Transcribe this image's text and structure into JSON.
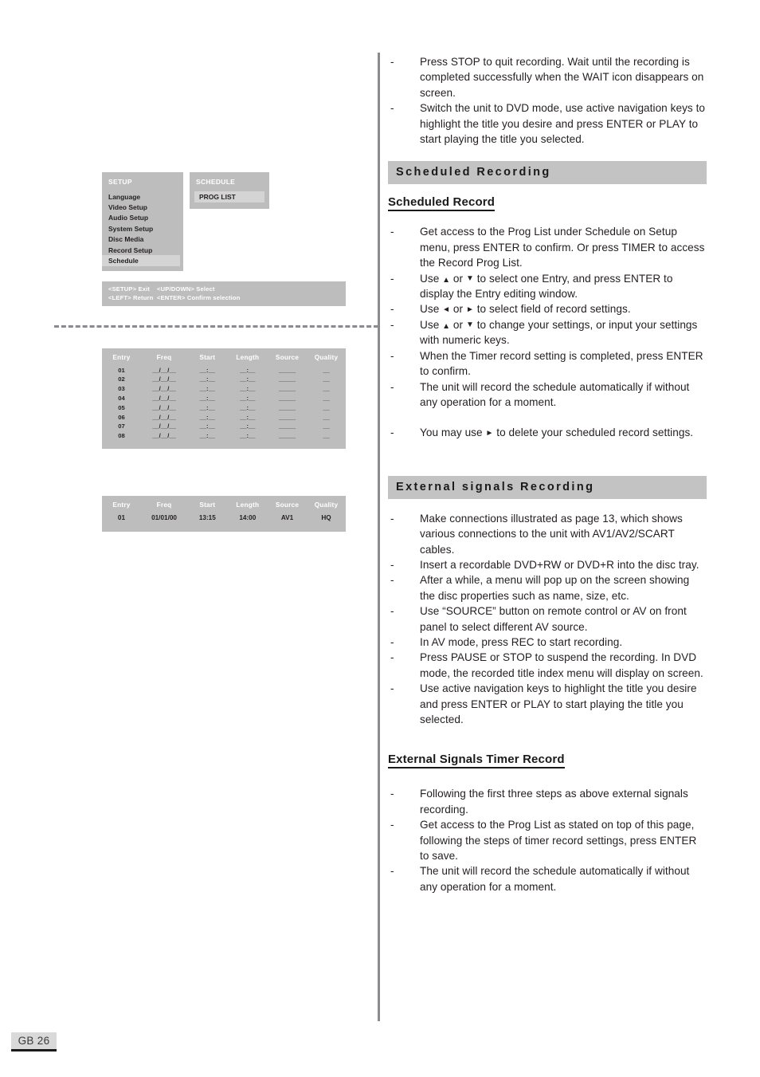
{
  "page": {
    "footer_label": "GB 26"
  },
  "osd_setup": {
    "setup_panel": {
      "title": "SETUP",
      "items": [
        {
          "label": "Language",
          "selected": false
        },
        {
          "label": "Video Setup",
          "selected": false
        },
        {
          "label": "Audio Setup",
          "selected": false
        },
        {
          "label": "System Setup",
          "selected": false
        },
        {
          "label": "Disc Media",
          "selected": false
        },
        {
          "label": "Record Setup",
          "selected": false
        },
        {
          "label": "Schedule",
          "selected": true
        }
      ]
    },
    "schedule_panel": {
      "title": "SCHEDULE",
      "items": [
        {
          "label": "PROG LIST",
          "selected": true
        }
      ]
    },
    "hints": {
      "row1": "<SETUP> Exit    <UP/DOWN> Select",
      "row2": "<LEFT> Return  <ENTER> Confirm selection"
    }
  },
  "prog_list_empty": {
    "columns": [
      "Entry",
      "Freq",
      "Start",
      "Length",
      "Source",
      "Quality"
    ],
    "rows": [
      [
        "01",
        "__/__/__",
        "__:__",
        "__:__",
        "_____",
        "__"
      ],
      [
        "02",
        "__/__/__",
        "__:__",
        "__:__",
        "_____",
        "__"
      ],
      [
        "03",
        "__/__/__",
        "__:__",
        "__:__",
        "_____",
        "__"
      ],
      [
        "04",
        "__/__/__",
        "__:__",
        "__:__",
        "_____",
        "__"
      ],
      [
        "05",
        "__/__/__",
        "__:__",
        "__:__",
        "_____",
        "__"
      ],
      [
        "06",
        "__/__/__",
        "__:__",
        "__:__",
        "_____",
        "__"
      ],
      [
        "07",
        "__/__/__",
        "__:__",
        "__:__",
        "_____",
        "__"
      ],
      [
        "08",
        "__/__/__",
        "__:__",
        "__:__",
        "_____",
        "__"
      ]
    ]
  },
  "prog_list_filled": {
    "columns": [
      "Entry",
      "Freq",
      "Start",
      "Length",
      "Source",
      "Quality"
    ],
    "rows": [
      [
        "01",
        "01/01/00",
        "13:15",
        "14:00",
        "AV1",
        "HQ"
      ]
    ]
  },
  "intro_bullets": [
    "Press STOP to quit recording. Wait until the recording is completed successfully when the WAIT icon disappears on screen.",
    "Switch the unit to DVD mode, use active navigation keys to highlight the title you desire and press ENTER or PLAY to start playing the title you selected."
  ],
  "scheduled_recording": {
    "section_title": "Scheduled  Recording",
    "sub_heading": "Scheduled Record",
    "bullets": [
      {
        "parts": [
          "Get access to the Prog List under Schedule on Setup menu, press ENTER to confirm. Or press TIMER to access the Record Prog List."
        ]
      },
      {
        "parts": [
          "Use ",
          "UP",
          " or ",
          "DOWN",
          " to select one Entry, and press ENTER to display the Entry editing window."
        ]
      },
      {
        "parts": [
          "Use ",
          "LEFT",
          " or ",
          "RIGHT",
          " to select field of record settings."
        ]
      },
      {
        "parts": [
          "Use ",
          "UP",
          " or ",
          "DOWN",
          " to change your settings, or input your settings with numeric keys."
        ]
      },
      {
        "parts": [
          "When the Timer record setting is completed, press ENTER to confirm."
        ]
      },
      {
        "parts": [
          "The unit will record the schedule automatically if without any operation for a moment."
        ]
      }
    ],
    "delete_bullet": {
      "parts": [
        "You may use ",
        "RIGHT",
        " to delete your scheduled record settings."
      ]
    }
  },
  "external_signals_recording": {
    "section_title": "External  signals  Recording",
    "bullets": [
      "Make connections illustrated as page 13, which shows various connections to the unit with AV1/AV2/SCART cables.",
      "Insert a recordable DVD+RW or DVD+R into the disc tray.",
      "After a while, a menu will pop up on the screen showing the disc properties such as name, size, etc.",
      "Use “SOURCE” button on remote control or AV on front panel to select different AV source.",
      "In AV mode, press REC to start recording.",
      "Press PAUSE or STOP to suspend the recording. In DVD mode, the recorded title index menu will display on screen.",
      "Use active navigation keys to highlight the title you desire and press ENTER or PLAY to start playing the title you selected."
    ]
  },
  "external_signals_timer_record": {
    "sub_heading": "External Signals Timer Record",
    "bullets": [
      "Following the first three steps as above external signals recording.",
      "Get access to the Prog List as stated on top of this page, following the steps of timer record settings, press ENTER to save.",
      "The unit will record the schedule automatically if without any operation for a moment."
    ]
  },
  "icons": {
    "arrow_up": "▲",
    "arrow_down": "▼",
    "arrow_left": "◄",
    "arrow_right": "►"
  },
  "colors": {
    "osd_background": "#bdbdbd",
    "osd_highlight": "#d4d4d4",
    "section_bar": "#c3c3c3",
    "divider": "#8a8a8f",
    "text": "#231f20",
    "footer_bg": "#d9d9d9"
  }
}
